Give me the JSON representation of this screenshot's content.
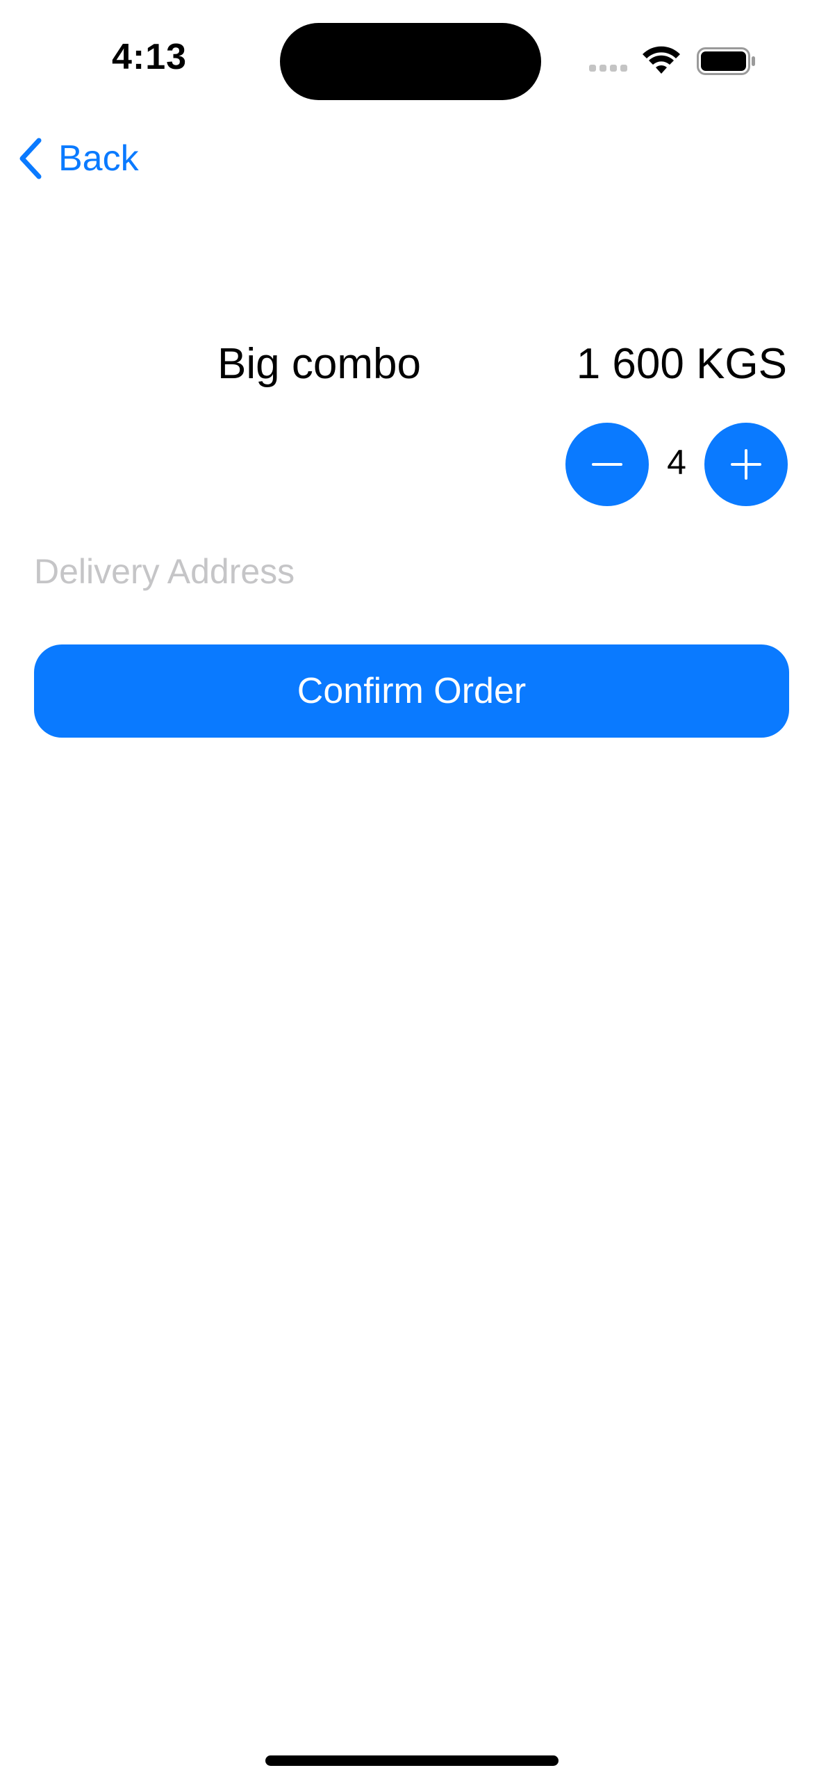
{
  "status_bar": {
    "time": "4:13"
  },
  "nav": {
    "back_label": "Back",
    "back_icon": "chevron-left-icon"
  },
  "product": {
    "name": "Big combo",
    "price": "1 600 KGS"
  },
  "stepper": {
    "quantity": "4",
    "minus_icon": "minus-icon",
    "plus_icon": "plus-icon"
  },
  "address": {
    "placeholder": "Delivery Address",
    "value": ""
  },
  "confirm": {
    "label": "Confirm Order"
  },
  "colors": {
    "accent": "#0a7aff",
    "placeholder": "#c5c5c7",
    "text": "#000000",
    "background": "#ffffff"
  }
}
